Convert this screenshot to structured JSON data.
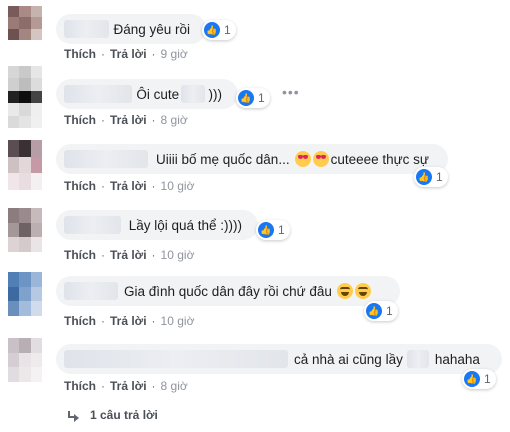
{
  "labels": {
    "like": "Thích",
    "reply": "Trả lời",
    "separator": "·"
  },
  "comments": [
    {
      "text": "Đáng yêu rồi",
      "reaction_count": "1",
      "time": "9 giờ"
    },
    {
      "text_a": "Ôi cute",
      "text_b": ")))",
      "reaction_count": "1",
      "time": "8 giờ"
    },
    {
      "text": "Uiiii bố mẹ quốc dân...",
      "text_after": "cuteeee thực sự",
      "reaction_count": "1",
      "time": "10 giờ"
    },
    {
      "text": "Lầy lội quá thể :))))",
      "reaction_count": "1",
      "time": "10 giờ"
    },
    {
      "text": "Gia đình quốc dân đây rồi chứ đâu",
      "reaction_count": "1",
      "time": "10 giờ"
    },
    {
      "text_a": "cả nhà ai cũng lầy",
      "text_b": "hahaha",
      "reaction_count": "1",
      "time": "8 giờ"
    }
  ],
  "more_options": "•••",
  "replies_link": "1 câu trả lời",
  "icons": {
    "like": "thumbs-up-icon",
    "emoji_hearts": "heart-eyes-emoji-icon",
    "emoji_laugh": "laughing-emoji-icon",
    "reply": "reply-arrow-icon"
  },
  "colors": {
    "like_blue": "#1877f2",
    "bubble_bg": "#f2f3f5",
    "link_gray": "#4b4f56"
  }
}
